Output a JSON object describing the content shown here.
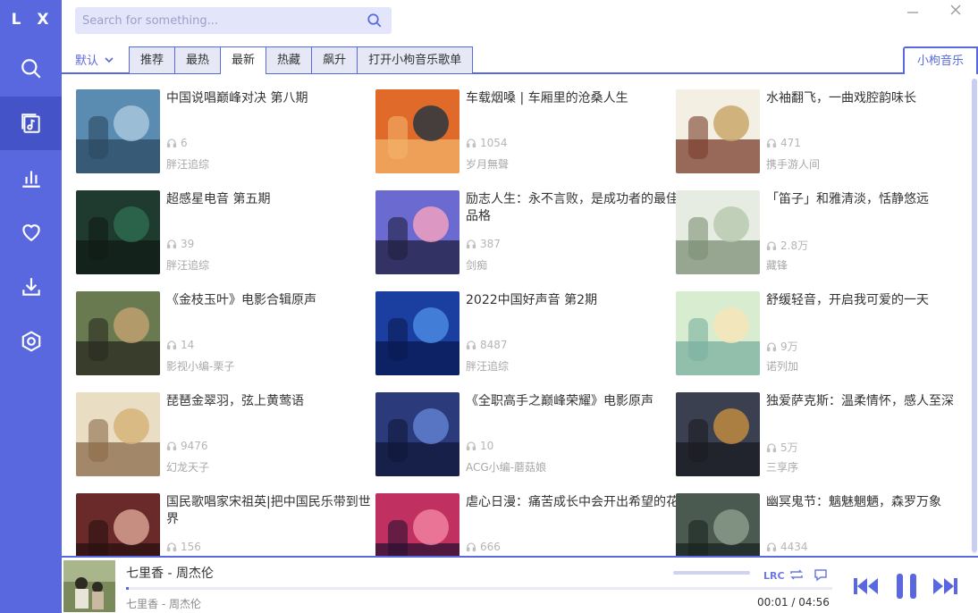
{
  "app": {
    "logo": "L X",
    "accent": "#5a68e0"
  },
  "sidebar": {
    "items": [
      {
        "name": "search",
        "icon": "search-icon"
      },
      {
        "name": "song-list",
        "icon": "music-list-icon",
        "active": true
      },
      {
        "name": "leaderboard",
        "icon": "chart-icon"
      },
      {
        "name": "favorites",
        "icon": "heart-icon"
      },
      {
        "name": "download",
        "icon": "download-icon"
      },
      {
        "name": "settings",
        "icon": "settings-icon"
      }
    ]
  },
  "search": {
    "placeholder": "Search for something..."
  },
  "tabs": {
    "sort_label": "默认",
    "items": [
      "推荐",
      "最热",
      "最新",
      "热藏",
      "飙升",
      "打开小枸音乐歌单"
    ],
    "active_index": 2,
    "source": "小枸音乐"
  },
  "playlists": [
    {
      "title": "中国说唱巅峰对决 第八期",
      "plays": "6",
      "author": "胖汪追综"
    },
    {
      "title": "车载烟嗓 | 车厢里的沧桑人生",
      "plays": "1054",
      "author": "岁月無聲"
    },
    {
      "title": "水袖翻飞，一曲戏腔韵味长",
      "plays": "471",
      "author": "携手游人间"
    },
    {
      "title": "超感星电音 第五期",
      "plays": "39",
      "author": "胖汪追综"
    },
    {
      "title": "励志人生：永不言败，是成功者的最佳品格",
      "plays": "387",
      "author": "剑痴"
    },
    {
      "title": "「笛子」和雅清淡，恬静悠远",
      "plays": "2.8万",
      "author": "藏锋"
    },
    {
      "title": "《金枝玉叶》电影合辑原声",
      "plays": "14",
      "author": "影视小编-栗子"
    },
    {
      "title": "2022中国好声音 第2期",
      "plays": "8487",
      "author": "胖汪追综"
    },
    {
      "title": "舒缓轻音，开启我可爱的一天",
      "plays": "9万",
      "author": "诺列加"
    },
    {
      "title": "琵琶金翠羽，弦上黄莺语",
      "plays": "9476",
      "author": "幻龙天子"
    },
    {
      "title": "《全职高手之巅峰荣耀》电影原声",
      "plays": "10",
      "author": "ACG小编-蘑菇娘"
    },
    {
      "title": "独爱萨克斯：温柔情怀，感人至深",
      "plays": "5万",
      "author": "三享序"
    },
    {
      "title": "国民歌唱家宋祖英|把中国民乐带到世界",
      "plays": "156",
      "author": ""
    },
    {
      "title": "虐心日漫：痛苦成长中会开出希望的花",
      "plays": "666",
      "author": ""
    },
    {
      "title": "幽冥鬼节：魑魅魍魉，森罗万象",
      "plays": "4434",
      "author": ""
    }
  ],
  "player": {
    "title": "七里香 - 周杰伦",
    "subtitle": "七里香 - 周杰伦",
    "time": "00:01 / 04:56",
    "progress": 0.0034,
    "lyric_button": "LRC"
  }
}
